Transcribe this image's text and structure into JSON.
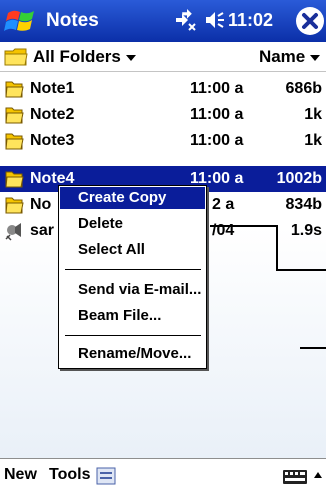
{
  "titlebar": {
    "app_title": "Notes",
    "clock": "11:02",
    "close_label": "X"
  },
  "folderbar": {
    "folder_label": "All Folders",
    "sort_label": "Name"
  },
  "files": [
    {
      "name": "Note1",
      "time": "11:00 a",
      "size": "686b",
      "icon": "folder-icon"
    },
    {
      "name": "Note2",
      "time": "11:00 a",
      "size": "1k",
      "icon": "folder-icon"
    },
    {
      "name": "Note3",
      "time": "11:00 a",
      "size": "1k",
      "icon": "folder-icon"
    },
    {
      "name": "Note4",
      "time": "11:00 a",
      "size": "1002b",
      "icon": "folder-icon",
      "selected": true
    },
    {
      "name": "No",
      "time": "2 a",
      "size": "834b",
      "icon": "folder-icon"
    },
    {
      "name": "sar",
      "time": "/04",
      "size": "1.9s",
      "icon": "sound-icon"
    }
  ],
  "context_menu": {
    "items": [
      {
        "label": "Create Copy",
        "highlighted": true
      },
      {
        "label": "Delete"
      },
      {
        "label": "Select All"
      },
      {
        "label": "Send via E-mail..."
      },
      {
        "label": "Beam File..."
      },
      {
        "label": "Rename/Move..."
      }
    ]
  },
  "bottombar": {
    "new_label": "New",
    "tools_label": "Tools"
  },
  "colors": {
    "title_bar": "#0b2fa8",
    "selection": "#0a1d9a",
    "folder_yellow": "#f5c400"
  }
}
